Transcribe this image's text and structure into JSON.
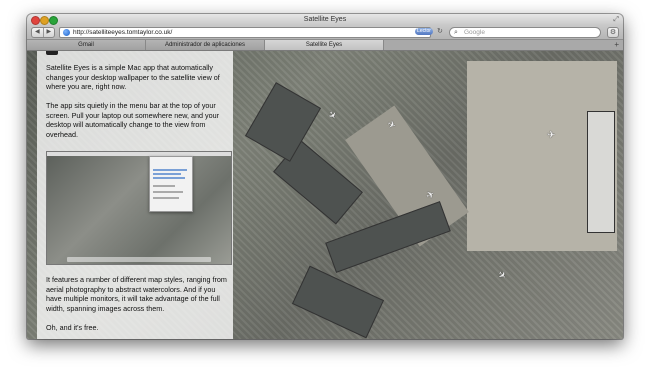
{
  "window": {
    "title": "Satellite Eyes"
  },
  "toolbar": {
    "url": "http://satelliteeyes.tomtaylor.co.uk/",
    "reader_label": "Lector",
    "search_placeholder": "Google"
  },
  "tabs": [
    {
      "label": "Gmail"
    },
    {
      "label": "Administrador de aplicaciones"
    },
    {
      "label": "Satellite Eyes"
    }
  ],
  "page": {
    "paragraphs": [
      "Satellite Eyes is a simple Mac app that automatically changes your desktop wallpaper to the satellite view of where you are, right now.",
      "The app sits quietly in the menu bar at the top of your screen. Pull your laptop out somewhere new, and your desktop will automatically change to the view from overhead.",
      "It features a number of different map styles, ranging from aerial photography to abstract watercolors. And if you have multiple monitors, it will take advantage of the full width, spanning images across them.",
      "Oh, and it's free."
    ]
  },
  "icons": {
    "back": "chevron-left-icon",
    "forward": "chevron-right-icon",
    "globe": "globe-icon",
    "reload": "reload-icon",
    "search": "search-icon",
    "settings": "gear-icon",
    "add_tab": "plus-icon"
  }
}
